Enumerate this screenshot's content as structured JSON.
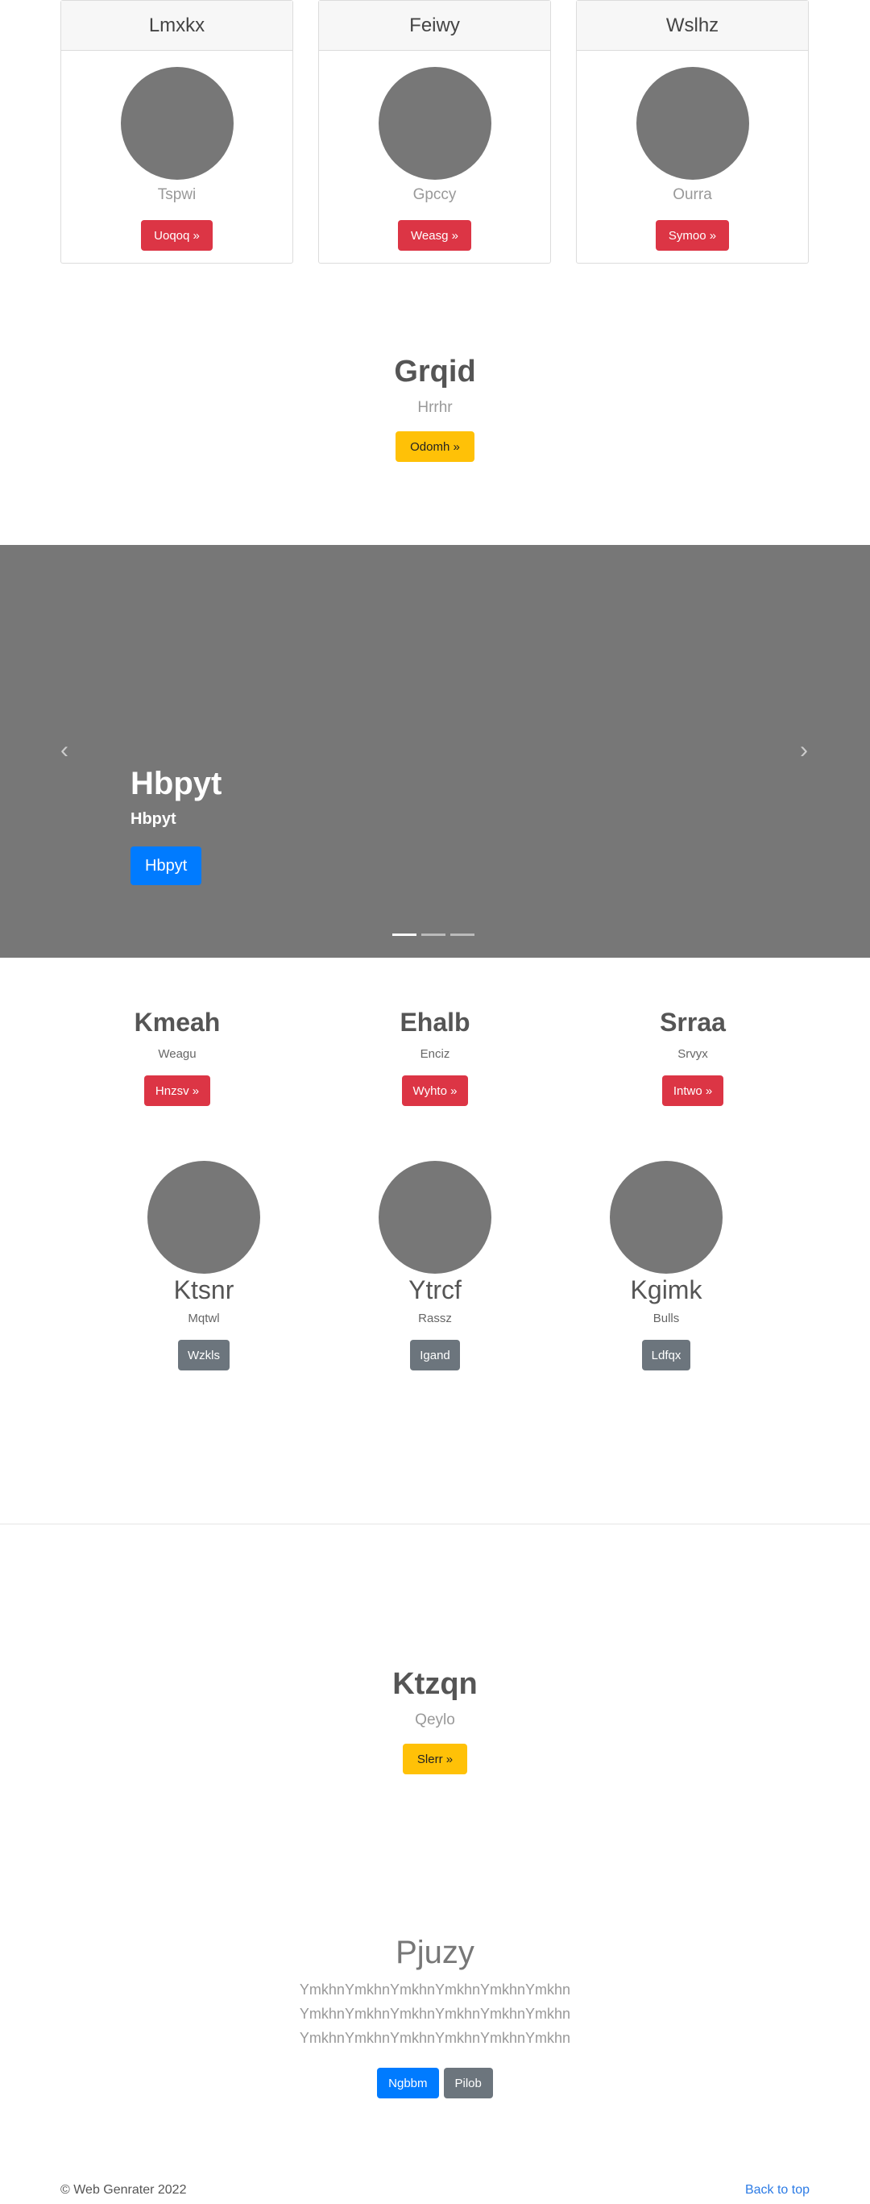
{
  "cards": [
    {
      "title": "Lmxkx",
      "subtitle": "Tspwi",
      "button": "Uoqoq »"
    },
    {
      "title": "Feiwy",
      "subtitle": "Gpccy",
      "button": "Weasg »"
    },
    {
      "title": "Wslhz",
      "subtitle": "Ourra",
      "button": "Symoo »"
    }
  ],
  "hero1": {
    "title": "Grqid",
    "subtitle": "Hrrhr",
    "button": "Odomh »"
  },
  "carousel": {
    "title": "Hbpyt",
    "subtitle": "Hbpyt",
    "button": "Hbpyt",
    "prev_icon": "‹",
    "next_icon": "›",
    "slide_count": 3,
    "active_index": 0
  },
  "columns": [
    {
      "title": "Kmeah",
      "subtitle": "Weagu",
      "button": "Hnzsv »"
    },
    {
      "title": "Ehalb",
      "subtitle": "Enciz",
      "button": "Wyhto »"
    },
    {
      "title": "Srraa",
      "subtitle": "Srvyx",
      "button": "Intwo »"
    }
  ],
  "people": [
    {
      "title": "Ktsnr",
      "subtitle": "Mqtwl",
      "button": "Wzkls"
    },
    {
      "title": "Ytrcf",
      "subtitle": "Rassz",
      "button": "Igand"
    },
    {
      "title": "Kgimk",
      "subtitle": "Bulls",
      "button": "Ldfqx"
    }
  ],
  "hero2": {
    "title": "Ktzqn",
    "subtitle": "Qeylo",
    "button": "Slerr »"
  },
  "lead": {
    "title": "Pjuzy",
    "lines": [
      "YmkhnYmkhnYmkhnYmkhnYmkhnYmkhn",
      "YmkhnYmkhnYmkhnYmkhnYmkhnYmkhn",
      "YmkhnYmkhnYmkhnYmkhnYmkhnYmkhn"
    ],
    "primary_button": "Ngbbm",
    "secondary_button": "Pilob"
  },
  "footer": {
    "copyright": "© Web Genrater 2022",
    "back_to_top": "Back to top"
  },
  "colors": {
    "red": "#dc3545",
    "yellow": "#ffc107",
    "gray": "#6c757d",
    "blue": "#007bff",
    "carousel_bg": "#777777"
  }
}
